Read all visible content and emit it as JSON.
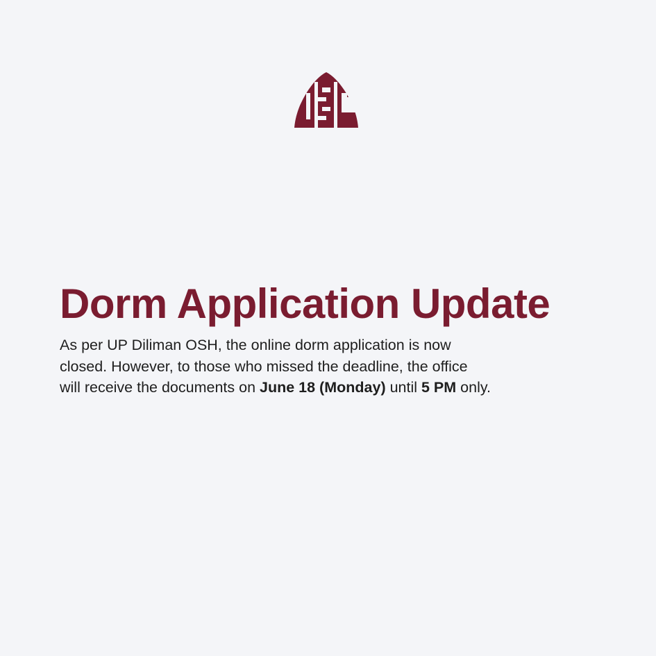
{
  "logo": {
    "text": "USC",
    "color": "#7a1c30"
  },
  "title": "Dorm Application Update",
  "body": {
    "line1": "As per UP Diliman OSH, the online dorm application is now",
    "line2": "closed. However, to those who missed the deadline, the office",
    "line3_pre": "will receive the documents on ",
    "line3_date": "June 18 (Monday)",
    "line3_mid": " until ",
    "line3_time": "5 PM",
    "line3_post": " only."
  },
  "colors": {
    "background": "#f4f5f8",
    "accent": "#7a1c30",
    "text": "#1e1e1e"
  }
}
